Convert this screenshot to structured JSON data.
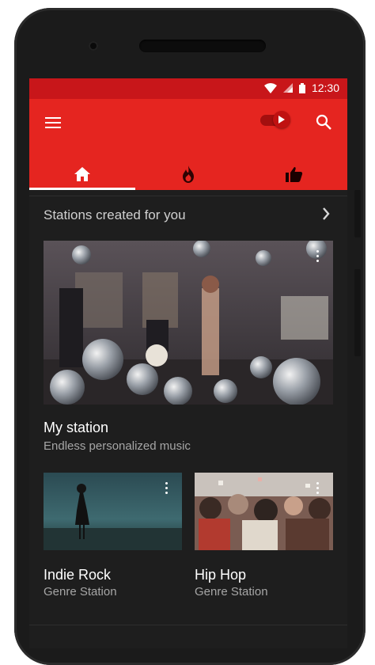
{
  "status": {
    "time": "12:30"
  },
  "appbar": {
    "menu_icon": "hamburger-icon",
    "toggle_icon": "play-toggle-icon",
    "search_icon": "search-icon",
    "tabs": [
      {
        "icon": "home-icon",
        "active": true
      },
      {
        "icon": "fire-icon",
        "active": false
      },
      {
        "icon": "thumbs-up-icon",
        "active": false
      }
    ]
  },
  "section": {
    "title": "Stations created for you",
    "arrow_icon": "chevron-right-icon"
  },
  "featured": {
    "title": "My station",
    "subtitle": "Endless personalized music",
    "more_icon": "more-vert-icon"
  },
  "stations": [
    {
      "title": "Indie Rock",
      "subtitle": "Genre Station",
      "more_icon": "more-vert-icon"
    },
    {
      "title": "Hip Hop",
      "subtitle": "Genre Station",
      "more_icon": "more-vert-icon"
    }
  ],
  "colors": {
    "primary": "#e52520",
    "status_bar": "#c8161a",
    "background": "#1e1e1e"
  }
}
